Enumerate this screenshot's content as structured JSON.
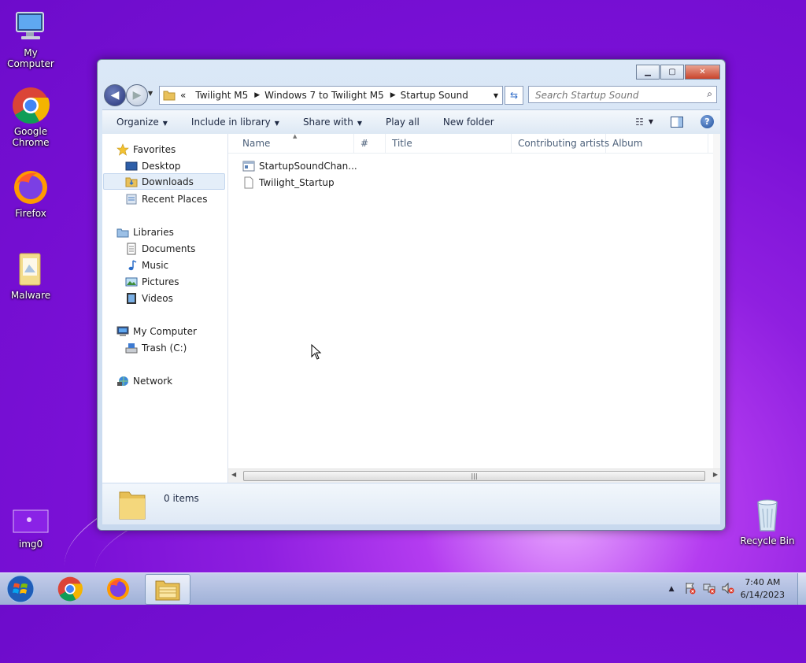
{
  "desktop": {
    "icons": [
      {
        "label": "My Computer"
      },
      {
        "label": "Google Chrome"
      },
      {
        "label": "Firefox"
      },
      {
        "label": "Malware"
      },
      {
        "label": "img0"
      },
      {
        "label": "Recycle Bin"
      }
    ]
  },
  "window": {
    "address": {
      "overflow": "«",
      "crumbs": [
        "Twilight M5",
        "Windows 7 to Twilight M5",
        "Startup Sound"
      ]
    },
    "search": {
      "placeholder": "Search Startup Sound"
    },
    "commands": {
      "organize": "Organize",
      "include": "Include in library",
      "share": "Share with",
      "play": "Play all",
      "new_folder": "New folder"
    },
    "nav": {
      "favorites": "Favorites",
      "desktop": "Desktop",
      "downloads": "Downloads",
      "recent": "Recent Places",
      "libraries": "Libraries",
      "documents": "Documents",
      "music": "Music",
      "pictures": "Pictures",
      "videos": "Videos",
      "computer": "My Computer",
      "trash": "Trash (C:)",
      "network": "Network"
    },
    "columns": [
      "Name",
      "#",
      "Title",
      "Contributing artists",
      "Album"
    ],
    "files": [
      {
        "name": "StartupSoundChan..."
      },
      {
        "name": "Twilight_Startup"
      }
    ],
    "status": {
      "items": "0 items"
    }
  },
  "taskbar": {
    "time": "7:40 AM",
    "date": "6/14/2023"
  },
  "colors": {
    "accent": "#7a10d6",
    "window_frame": "#c8d9ee",
    "selection": "#e4eef9"
  }
}
